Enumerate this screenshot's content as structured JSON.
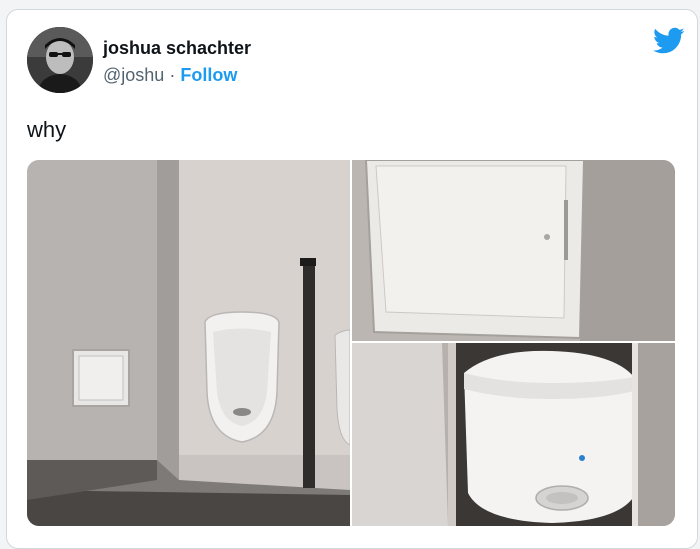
{
  "user": {
    "display_name": "joshua schachter",
    "handle": "@joshu",
    "separator": "·",
    "follow_label": "Follow"
  },
  "tweet": {
    "text": "why"
  },
  "icons": {
    "brand": "twitter-bird-icon",
    "avatar": "user-avatar"
  },
  "colors": {
    "accent": "#1d9bf0",
    "text_primary": "#0f1419",
    "text_secondary": "#536471",
    "border": "#cfd9de"
  },
  "media": {
    "photos": [
      "photo-urinal-wall",
      "photo-access-panel-closed",
      "photo-access-panel-open"
    ]
  }
}
